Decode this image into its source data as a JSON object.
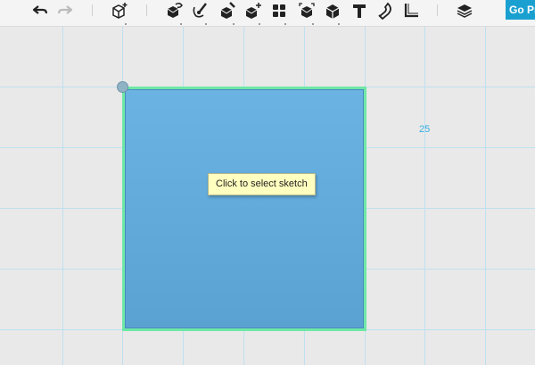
{
  "toolbar": {
    "tools": [
      {
        "name": "undo-icon"
      },
      {
        "name": "redo-icon"
      },
      {
        "name": "add-primitive-icon"
      },
      {
        "name": "sketch-tool-icon"
      },
      {
        "name": "paint-brush-icon"
      },
      {
        "name": "construct-tool-icon"
      },
      {
        "name": "modify-tool-icon"
      },
      {
        "name": "pattern-tool-icon"
      },
      {
        "name": "group-tool-icon"
      },
      {
        "name": "combine-tool-icon"
      },
      {
        "name": "text-tool-icon"
      },
      {
        "name": "snap-magnet-icon"
      },
      {
        "name": "measure-tool-icon"
      },
      {
        "name": "material-layers-icon"
      }
    ],
    "go_pro_label": "Go Pro"
  },
  "canvas": {
    "dimension_label": "25",
    "tooltip": "Click to select sketch",
    "colors": {
      "background": "#e9e9e9",
      "grid": "#bfe0ef",
      "sketch_fill": "#5aa2d2",
      "sketch_outline": "#6ee8a6",
      "tooltip_bg": "#ffffbf",
      "dimension_text": "#38aee0",
      "accent": "#1aa0d0"
    }
  }
}
